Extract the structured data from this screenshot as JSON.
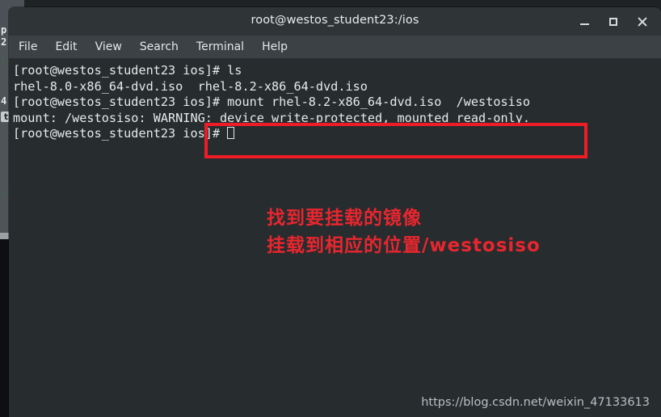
{
  "window": {
    "title": "root@westos_student23:/ios",
    "buttons": {
      "minimize": "minimize",
      "maximize": "maximize",
      "close": "close"
    }
  },
  "menubar": {
    "items": [
      {
        "label": "File"
      },
      {
        "label": "Edit"
      },
      {
        "label": "View"
      },
      {
        "label": "Search"
      },
      {
        "label": "Terminal"
      },
      {
        "label": "Help"
      }
    ]
  },
  "terminal": {
    "lines": [
      "[root@westos_student23 ios]# ls",
      "rhel-8.0-x86_64-dvd.iso  rhel-8.2-x86_64-dvd.iso",
      "[root@westos_student23 ios]# mount rhel-8.2-x86_64-dvd.iso  /westosiso",
      "mount: /westosiso: WARNING: device write-protected, mounted read-only.",
      "[root@westos_student23 ios]# "
    ],
    "prompt_cursor": ""
  },
  "annotations": {
    "highlight_box_color": "#ee1c25",
    "text_color": "#e8262e",
    "line1": "找到要挂载的镜像",
    "line2": "挂载到相应的位置/westosiso"
  },
  "watermark": {
    "text": "https://blog.csdn.net/weixin_47133613"
  },
  "background": {
    "left_fragments": [
      "p",
      "2",
      "4",
      "t"
    ],
    "faint_text": "li"
  },
  "colors": {
    "titlebar": "#2f3437",
    "menubar": "#3b4145",
    "terminal_bg": "#272c2f",
    "terminal_fg": "#e6eaec",
    "accent_red": "#ee1c25"
  }
}
